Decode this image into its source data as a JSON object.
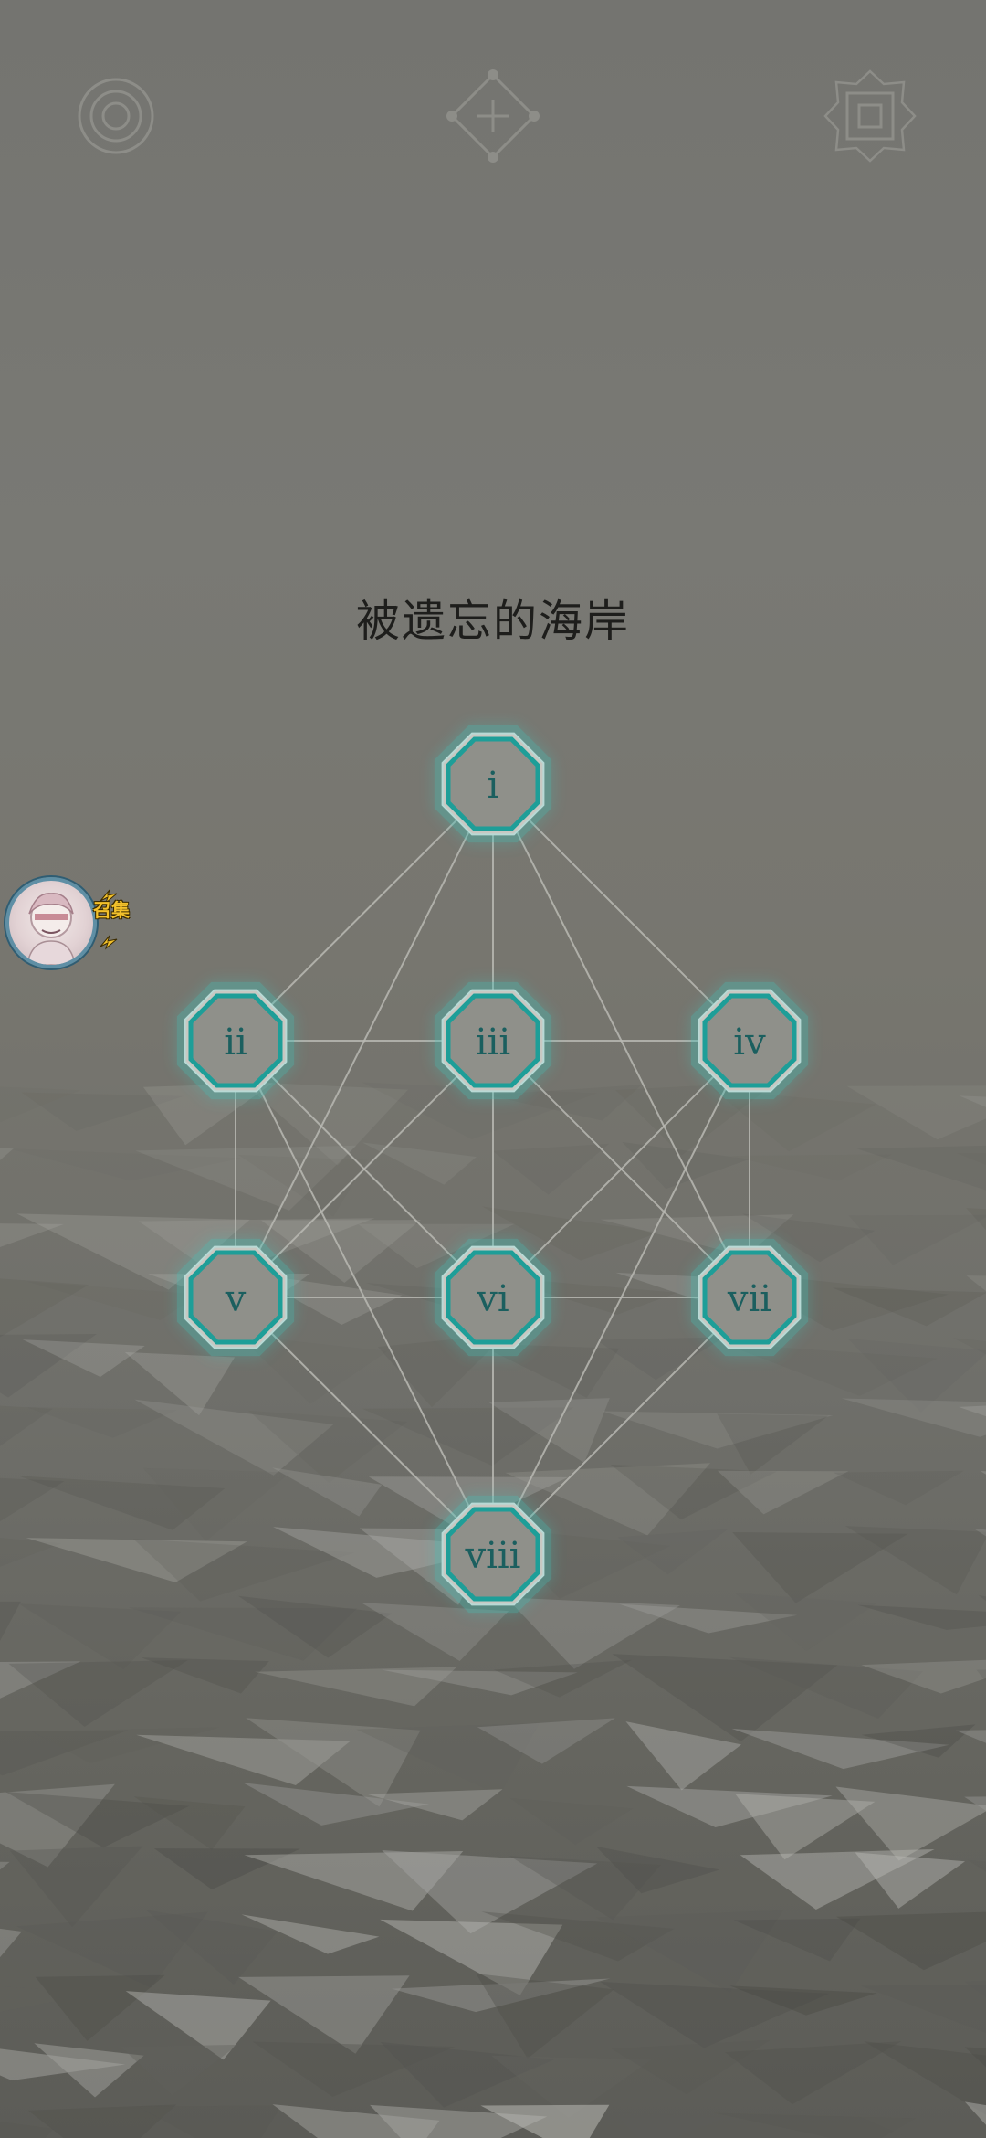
{
  "toolbar": {
    "left_icon": "concentric-circles-icon",
    "center_icon": "diamond-plus-icon",
    "right_icon": "square-frame-icon"
  },
  "level": {
    "title": "被遗忘的海岸"
  },
  "nodes": [
    {
      "id": "i",
      "label": "i"
    },
    {
      "id": "ii",
      "label": "ii"
    },
    {
      "id": "iii",
      "label": "iii"
    },
    {
      "id": "iv",
      "label": "iv"
    },
    {
      "id": "v",
      "label": "v"
    },
    {
      "id": "vi",
      "label": "vi"
    },
    {
      "id": "vii",
      "label": "vii"
    },
    {
      "id": "viii",
      "label": "viii"
    }
  ],
  "edges": [
    [
      "i",
      "ii"
    ],
    [
      "i",
      "iii"
    ],
    [
      "i",
      "iv"
    ],
    [
      "i",
      "v"
    ],
    [
      "i",
      "vii"
    ],
    [
      "ii",
      "iii"
    ],
    [
      "ii",
      "v"
    ],
    [
      "ii",
      "vi"
    ],
    [
      "ii",
      "viii"
    ],
    [
      "iii",
      "iv"
    ],
    [
      "iii",
      "v"
    ],
    [
      "iii",
      "vi"
    ],
    [
      "iii",
      "vii"
    ],
    [
      "iv",
      "vi"
    ],
    [
      "iv",
      "vii"
    ],
    [
      "iv",
      "viii"
    ],
    [
      "v",
      "vi"
    ],
    [
      "v",
      "viii"
    ],
    [
      "vi",
      "vii"
    ],
    [
      "vi",
      "viii"
    ],
    [
      "vii",
      "viii"
    ]
  ],
  "floating_avatar": {
    "badge": "召集"
  },
  "colors": {
    "node_fill": "#8f908a",
    "node_border": "#1e9e98",
    "node_text": "#1b5f5f",
    "edge": "#b9b9b3",
    "title": "#1e1e1c",
    "toolbar_icon": "#8d8d88"
  }
}
